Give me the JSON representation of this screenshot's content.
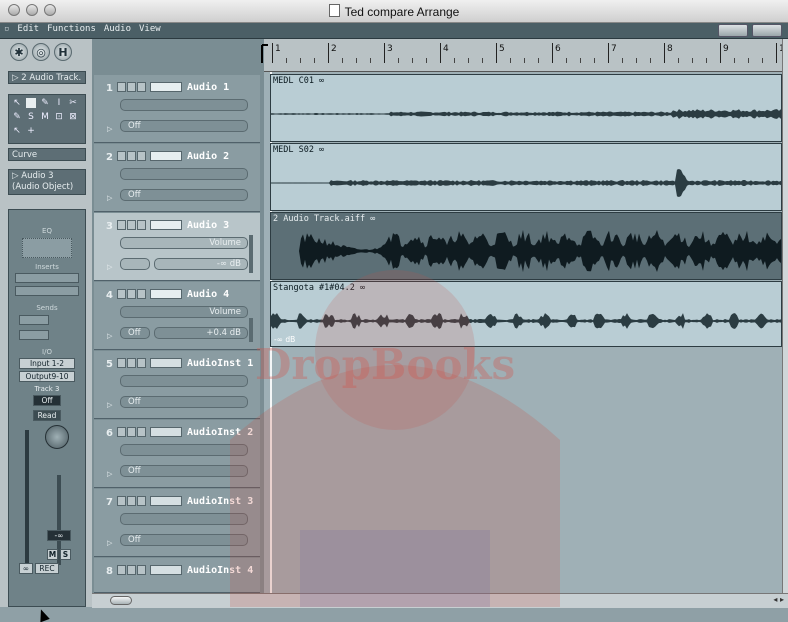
{
  "window": {
    "title": "Ted compare Arrange"
  },
  "menu": [
    "Edit",
    "Functions",
    "Audio",
    "View"
  ],
  "toolbar": {
    "buttons": [
      "catch-icon",
      "link-icon",
      "hide-icon"
    ],
    "hide_label": "H"
  },
  "left": {
    "track_selector": "2 Audio Track.",
    "curve_label": "Curve",
    "object_line1": "Audio 3",
    "object_line2": "(Audio Object)",
    "strip": {
      "eq": "EQ",
      "inserts": "Inserts",
      "sends": "Sends",
      "io": "I/O",
      "input": "Input 1-2",
      "output": "Output9-10",
      "track": "Track 3",
      "off": "Off",
      "read": "Read",
      "vol": "-∞",
      "mute": "M",
      "solo": "S",
      "link": "∞",
      "rec": "REC"
    }
  },
  "tracks": [
    {
      "num": "1",
      "name": "Audio 1",
      "left": "Off",
      "right": ""
    },
    {
      "num": "2",
      "name": "Audio 2",
      "left": "Off",
      "right": ""
    },
    {
      "num": "3",
      "name": "Audio 3",
      "vol_label": "Volume",
      "right": "-∞ dB",
      "left": ""
    },
    {
      "num": "4",
      "name": "Audio 4",
      "vol_label": "Volume",
      "left": "Off",
      "right": "+0.4 dB"
    },
    {
      "num": "5",
      "name": "AudioInst 1",
      "left": "Off",
      "right": ""
    },
    {
      "num": "6",
      "name": "AudioInst 2",
      "left": "Off",
      "right": ""
    },
    {
      "num": "7",
      "name": "AudioInst 3",
      "left": "Off",
      "right": ""
    },
    {
      "num": "8",
      "name": "AudioInst 4",
      "left": "",
      "right": ""
    }
  ],
  "ruler": {
    "bars": [
      "1",
      "2",
      "3",
      "4",
      "5",
      "6",
      "7",
      "8",
      "9",
      "1"
    ]
  },
  "regions": [
    {
      "label": "MEDL C01 ∞",
      "dark": false
    },
    {
      "label": "MEDL S02 ∞",
      "dark": false
    },
    {
      "label": "2 Audio Track.aiff ∞",
      "dark": true
    },
    {
      "label": "Stangota #1#04.2 ∞",
      "dark": false,
      "db": "-∞ dB"
    }
  ],
  "watermark": "DropBooks"
}
